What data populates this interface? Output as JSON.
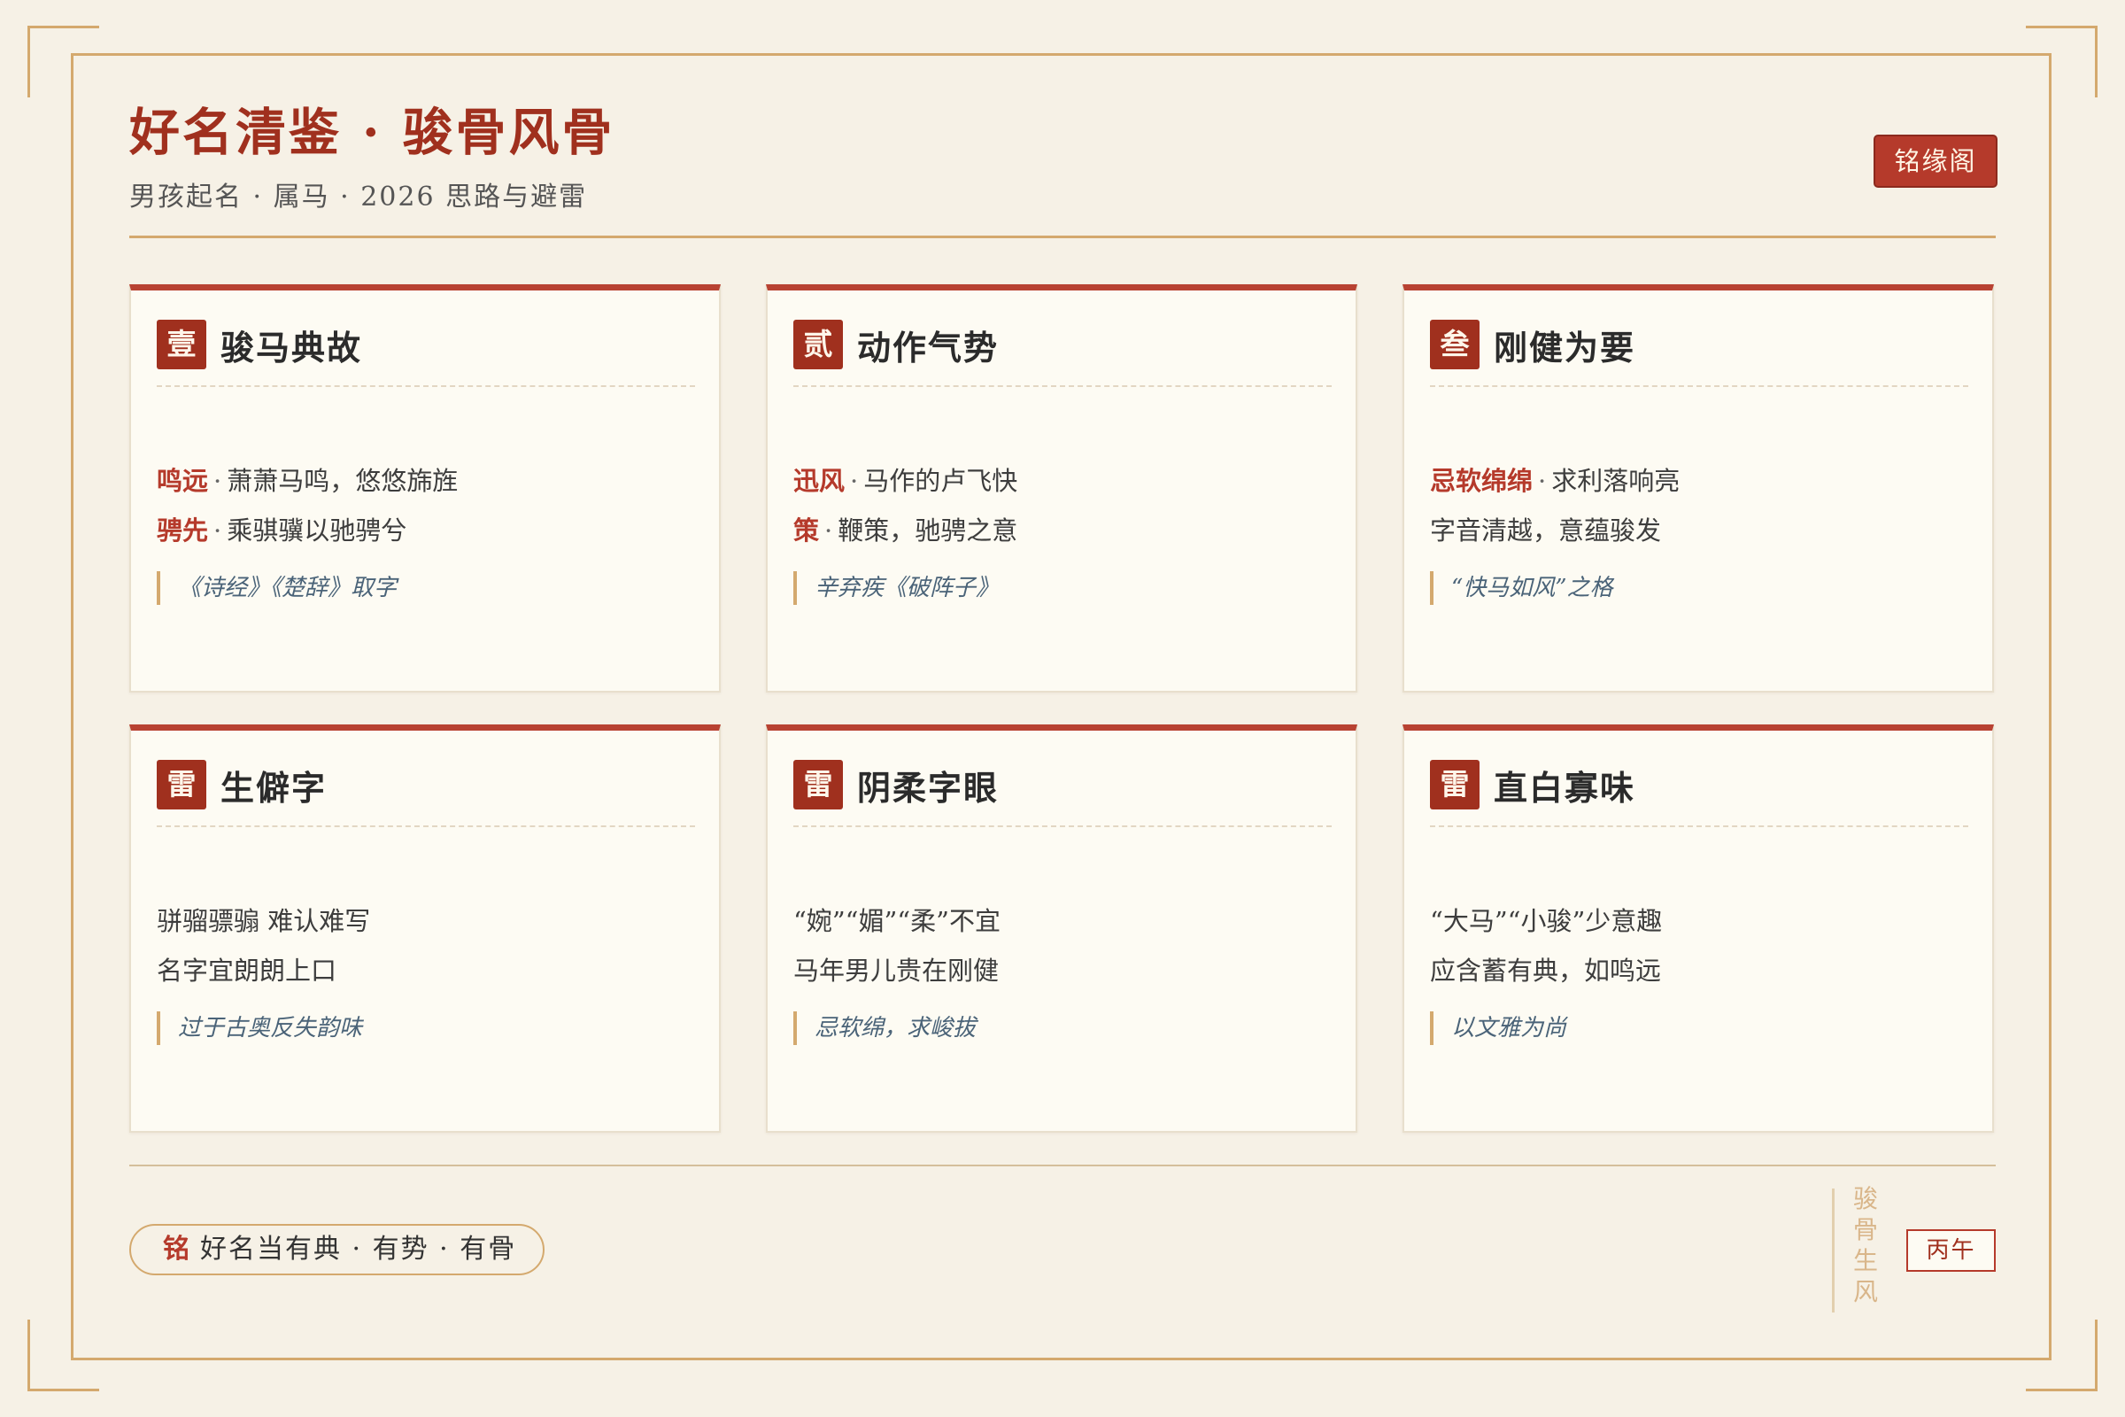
{
  "header": {
    "title": "好名清鉴 · 骏骨风骨",
    "subtitle": "男孩起名 · 属马 · 2026 思路与避雷",
    "brand": "铭缘阁"
  },
  "cards": [
    {
      "seal": "壹",
      "title": "骏马典故",
      "line1": {
        "key": "鸣远",
        "text": "萧萧马鸣，悠悠旆旌"
      },
      "line2": {
        "key": "骋先",
        "text": "乘骐骥以驰骋兮"
      },
      "note": "《诗经》《楚辞》取字"
    },
    {
      "seal": "贰",
      "title": "动作气势",
      "line1": {
        "key": "迅风",
        "text": "马作的卢飞快"
      },
      "line2": {
        "key": "策",
        "text": "鞭策，驰骋之意"
      },
      "note": "辛弃疾《破阵子》"
    },
    {
      "seal": "叁",
      "title": "刚健为要",
      "line1": {
        "key": "忌软绵绵",
        "text": "求利落响亮"
      },
      "line2": {
        "text": "字音清越，意蕴骏发"
      },
      "note": "“快马如风”之格"
    },
    {
      "seal": "雷",
      "title": "生僻字",
      "line1": {
        "text": "骈骝骠骟 难认难写"
      },
      "line2": {
        "text": "名字宜朗朗上口"
      },
      "note": "过于古奥反失韵味"
    },
    {
      "seal": "雷",
      "title": "阴柔字眼",
      "line1": {
        "text": "“婉”“媚”“柔”不宜"
      },
      "line2": {
        "text": "马年男儿贵在刚健"
      },
      "note": "忌软绵，求峻拔"
    },
    {
      "seal": "雷",
      "title": "直白寡味",
      "line1": {
        "text": "“大马”“小骏”少意趣"
      },
      "line2": {
        "text": "应含蓄有典，如鸣远"
      },
      "note": "以文雅为尚"
    }
  ],
  "footer": {
    "motto_mark": "铭",
    "motto": "好名当有典 · 有势 · 有骨",
    "vertical_text": "骏骨生风",
    "year_stamp": "丙午"
  },
  "colors": {
    "accent": "#b53a2b",
    "gold": "#d4a96e",
    "background": "#f6f1e6"
  }
}
